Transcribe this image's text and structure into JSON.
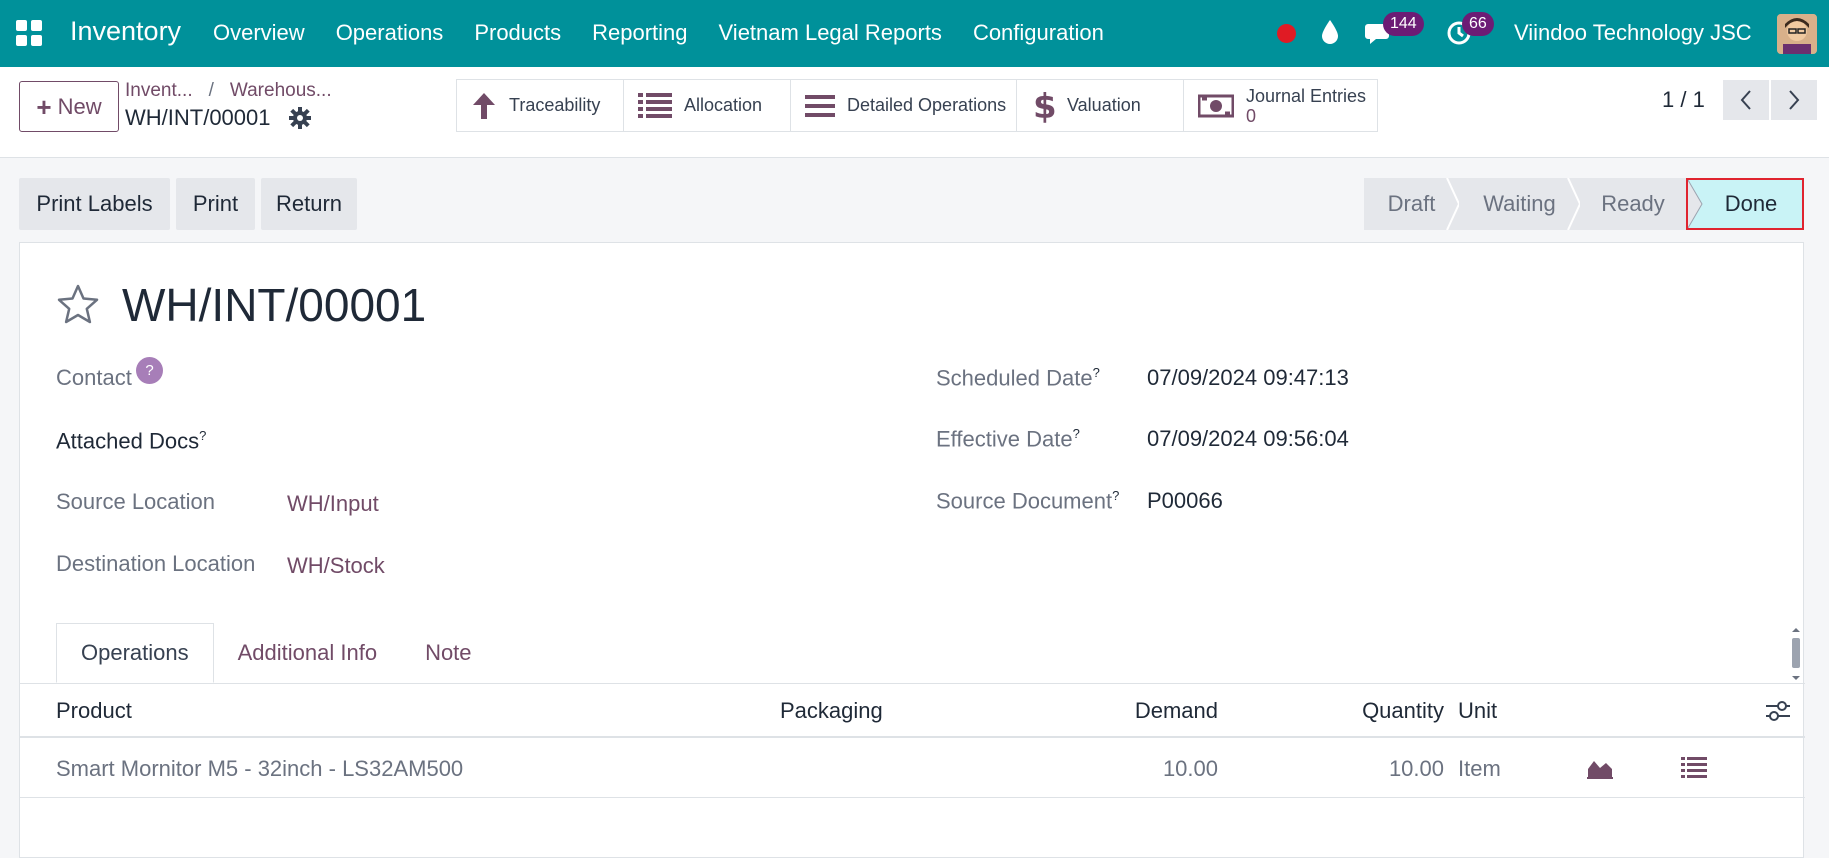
{
  "navbar": {
    "app_name": "Inventory",
    "menu": [
      "Overview",
      "Operations",
      "Products",
      "Reporting",
      "Vietnam Legal Reports",
      "Configuration"
    ],
    "chat_count": "144",
    "activity_count": "66",
    "company": "Viindoo Technology JSC"
  },
  "control": {
    "new_label": "New",
    "breadcrumb": [
      "Invent...",
      "Warehous..."
    ],
    "record_name": "WH/INT/00001",
    "smart_buttons": {
      "traceability": "Traceability",
      "allocation": "Allocation",
      "detailed_operations": "Detailed Operations",
      "valuation": "Valuation",
      "journal_entries": "Journal Entries",
      "journal_entries_count": "0"
    },
    "pager": "1 / 1"
  },
  "actions": {
    "print_labels": "Print Labels",
    "print": "Print",
    "return": "Return"
  },
  "status_stages": [
    "Draft",
    "Waiting",
    "Ready",
    "Done"
  ],
  "form": {
    "title": "WH/INT/00001",
    "contact_label": "Contact",
    "contact_help": "?",
    "attached_docs_label": "Attached Docs",
    "help_mark": "?",
    "source_location_label": "Source Location",
    "source_location": "WH/Input",
    "destination_location_label": "Destination Location",
    "destination_location": "WH/Stock",
    "scheduled_date_label": "Scheduled Date",
    "scheduled_date": "07/09/2024 09:47:13",
    "effective_date_label": "Effective Date",
    "effective_date": "07/09/2024 09:56:04",
    "source_document_label": "Source Document",
    "source_document": "P00066"
  },
  "tabs": [
    "Operations",
    "Additional Info",
    "Note"
  ],
  "table": {
    "headers": {
      "product": "Product",
      "packaging": "Packaging",
      "demand": "Demand",
      "quantity": "Quantity",
      "unit": "Unit"
    },
    "rows": [
      {
        "product": "Smart Mornitor M5 - 32inch - LS32AM500",
        "packaging": "",
        "demand": "10.00",
        "quantity": "10.00",
        "unit": "Item"
      }
    ]
  }
}
